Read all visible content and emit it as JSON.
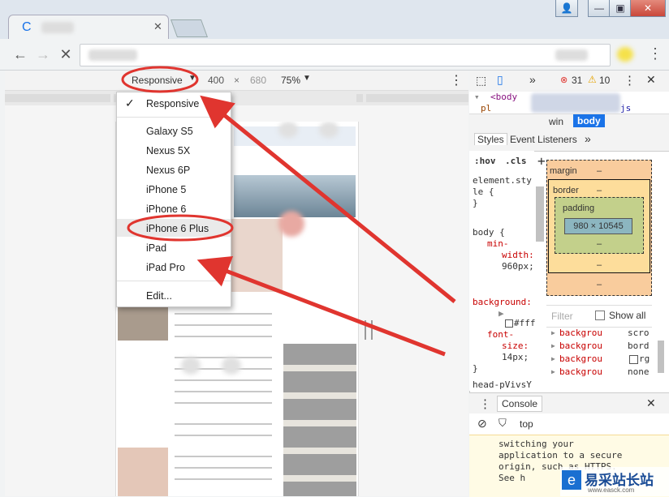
{
  "browser": {
    "tab_title": "C",
    "nav_icons": [
      "back-arrow-icon",
      "forward-arrow-icon",
      "stop-loading-icon"
    ],
    "menu_icon": "kebab-menu-icon"
  },
  "device_toolbar": {
    "device_selected": "Responsive",
    "width": "400",
    "times": "×",
    "height": "680",
    "zoom": "75%"
  },
  "device_menu": {
    "items": [
      "Responsive",
      "Galaxy S5",
      "Nexus 5X",
      "Nexus 6P",
      "iPhone 5",
      "iPhone 6",
      "iPhone 6 Plus",
      "iPad",
      "iPad Pro"
    ],
    "edit": "Edit...",
    "checked_index": 0,
    "highlighted_index": 6
  },
  "devtools": {
    "overflow": "»",
    "errors": "31",
    "warnings": "10",
    "elements_line1": "<body",
    "elements_line2": "pl",
    "elements_line2_tail": "js",
    "breadcrumb_win": "win",
    "breadcrumb_body": "body",
    "tabs": [
      "Styles",
      "Event Listeners",
      "»"
    ],
    "styles_filter_hov": ":hov",
    "styles_filter_cls": ".cls",
    "styles_plus": "+",
    "css_lines": [
      "element.sty",
      "le {",
      "}",
      "body {",
      "min-",
      "width:",
      "960px;",
      "background:",
      "#fff",
      "font-",
      "size:",
      "14px;",
      "}",
      "head-pVivsY"
    ],
    "box_margin": "margin",
    "box_border": "border",
    "box_padding": "padding",
    "box_dash": "–",
    "box_size": "980 × 10545",
    "filter_placeholder": "Filter",
    "show_all": "Show all",
    "computed_props": [
      "backgrou",
      "backgrou",
      "backgrou",
      "backgrou"
    ],
    "computed_values": [
      "scro",
      "bord",
      "rg",
      "none"
    ],
    "console_tab": "Console",
    "console_context": "top",
    "console_message": [
      "switching your",
      "application to a secure",
      "origin, such as HTTPS.",
      "See h"
    ]
  },
  "watermark": {
    "title": "易采站长站",
    "subtitle": "www.easck.com"
  },
  "colors": {
    "annotation_red": "#e0352f",
    "box_margin": "#f9cc9d",
    "box_border": "#fddd9b",
    "box_padding": "#c3d08b",
    "box_content": "#8cb6c0",
    "link_blue": "#1a73e8"
  }
}
